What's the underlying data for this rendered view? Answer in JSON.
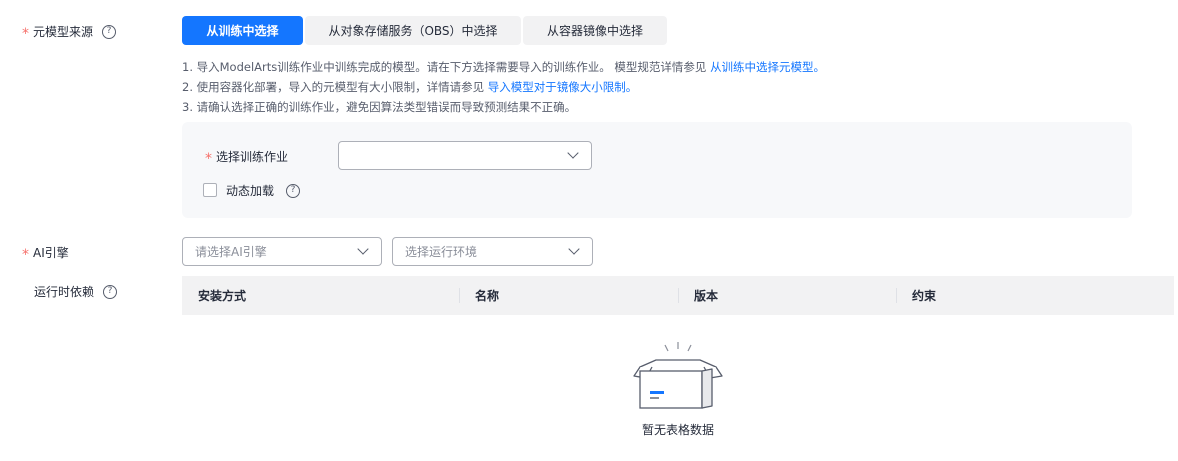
{
  "source": {
    "label": "元模型来源",
    "help_icon": "?",
    "tabs": [
      {
        "label": "从训练中选择",
        "active": true
      },
      {
        "label": "从对象存储服务（OBS）中选择",
        "active": false
      },
      {
        "label": "从容器镜像中选择",
        "active": false
      }
    ],
    "notes": {
      "n1_text": "1. 导入ModelArts训练作业中训练完成的模型。请在下方选择需要导入的训练作业。 模型规范详情参见 ",
      "n1_link": "从训练中选择元模型。",
      "n2_text": "2. 使用容器化部署，导入的元模型有大小限制，详情请参见 ",
      "n2_link": "导入模型对于镜像大小限制。",
      "n3_text": "3. 请确认选择正确的训练作业，避免因算法类型错误而导致预测结果不正确。"
    },
    "training_job": {
      "label": "选择训练作业",
      "value": ""
    },
    "dynamic_loading": {
      "label": "动态加载",
      "checked": false
    }
  },
  "ai_engine": {
    "label": "AI引擎",
    "engine_placeholder": "请选择AI引擎",
    "env_placeholder": "选择运行环境"
  },
  "runtime_deps": {
    "label": "运行时依赖",
    "columns": [
      "安装方式",
      "名称",
      "版本",
      "约束"
    ],
    "empty_text": "暂无表格数据"
  },
  "colors": {
    "accent": "#1476ff",
    "required": "#f66f6a"
  }
}
